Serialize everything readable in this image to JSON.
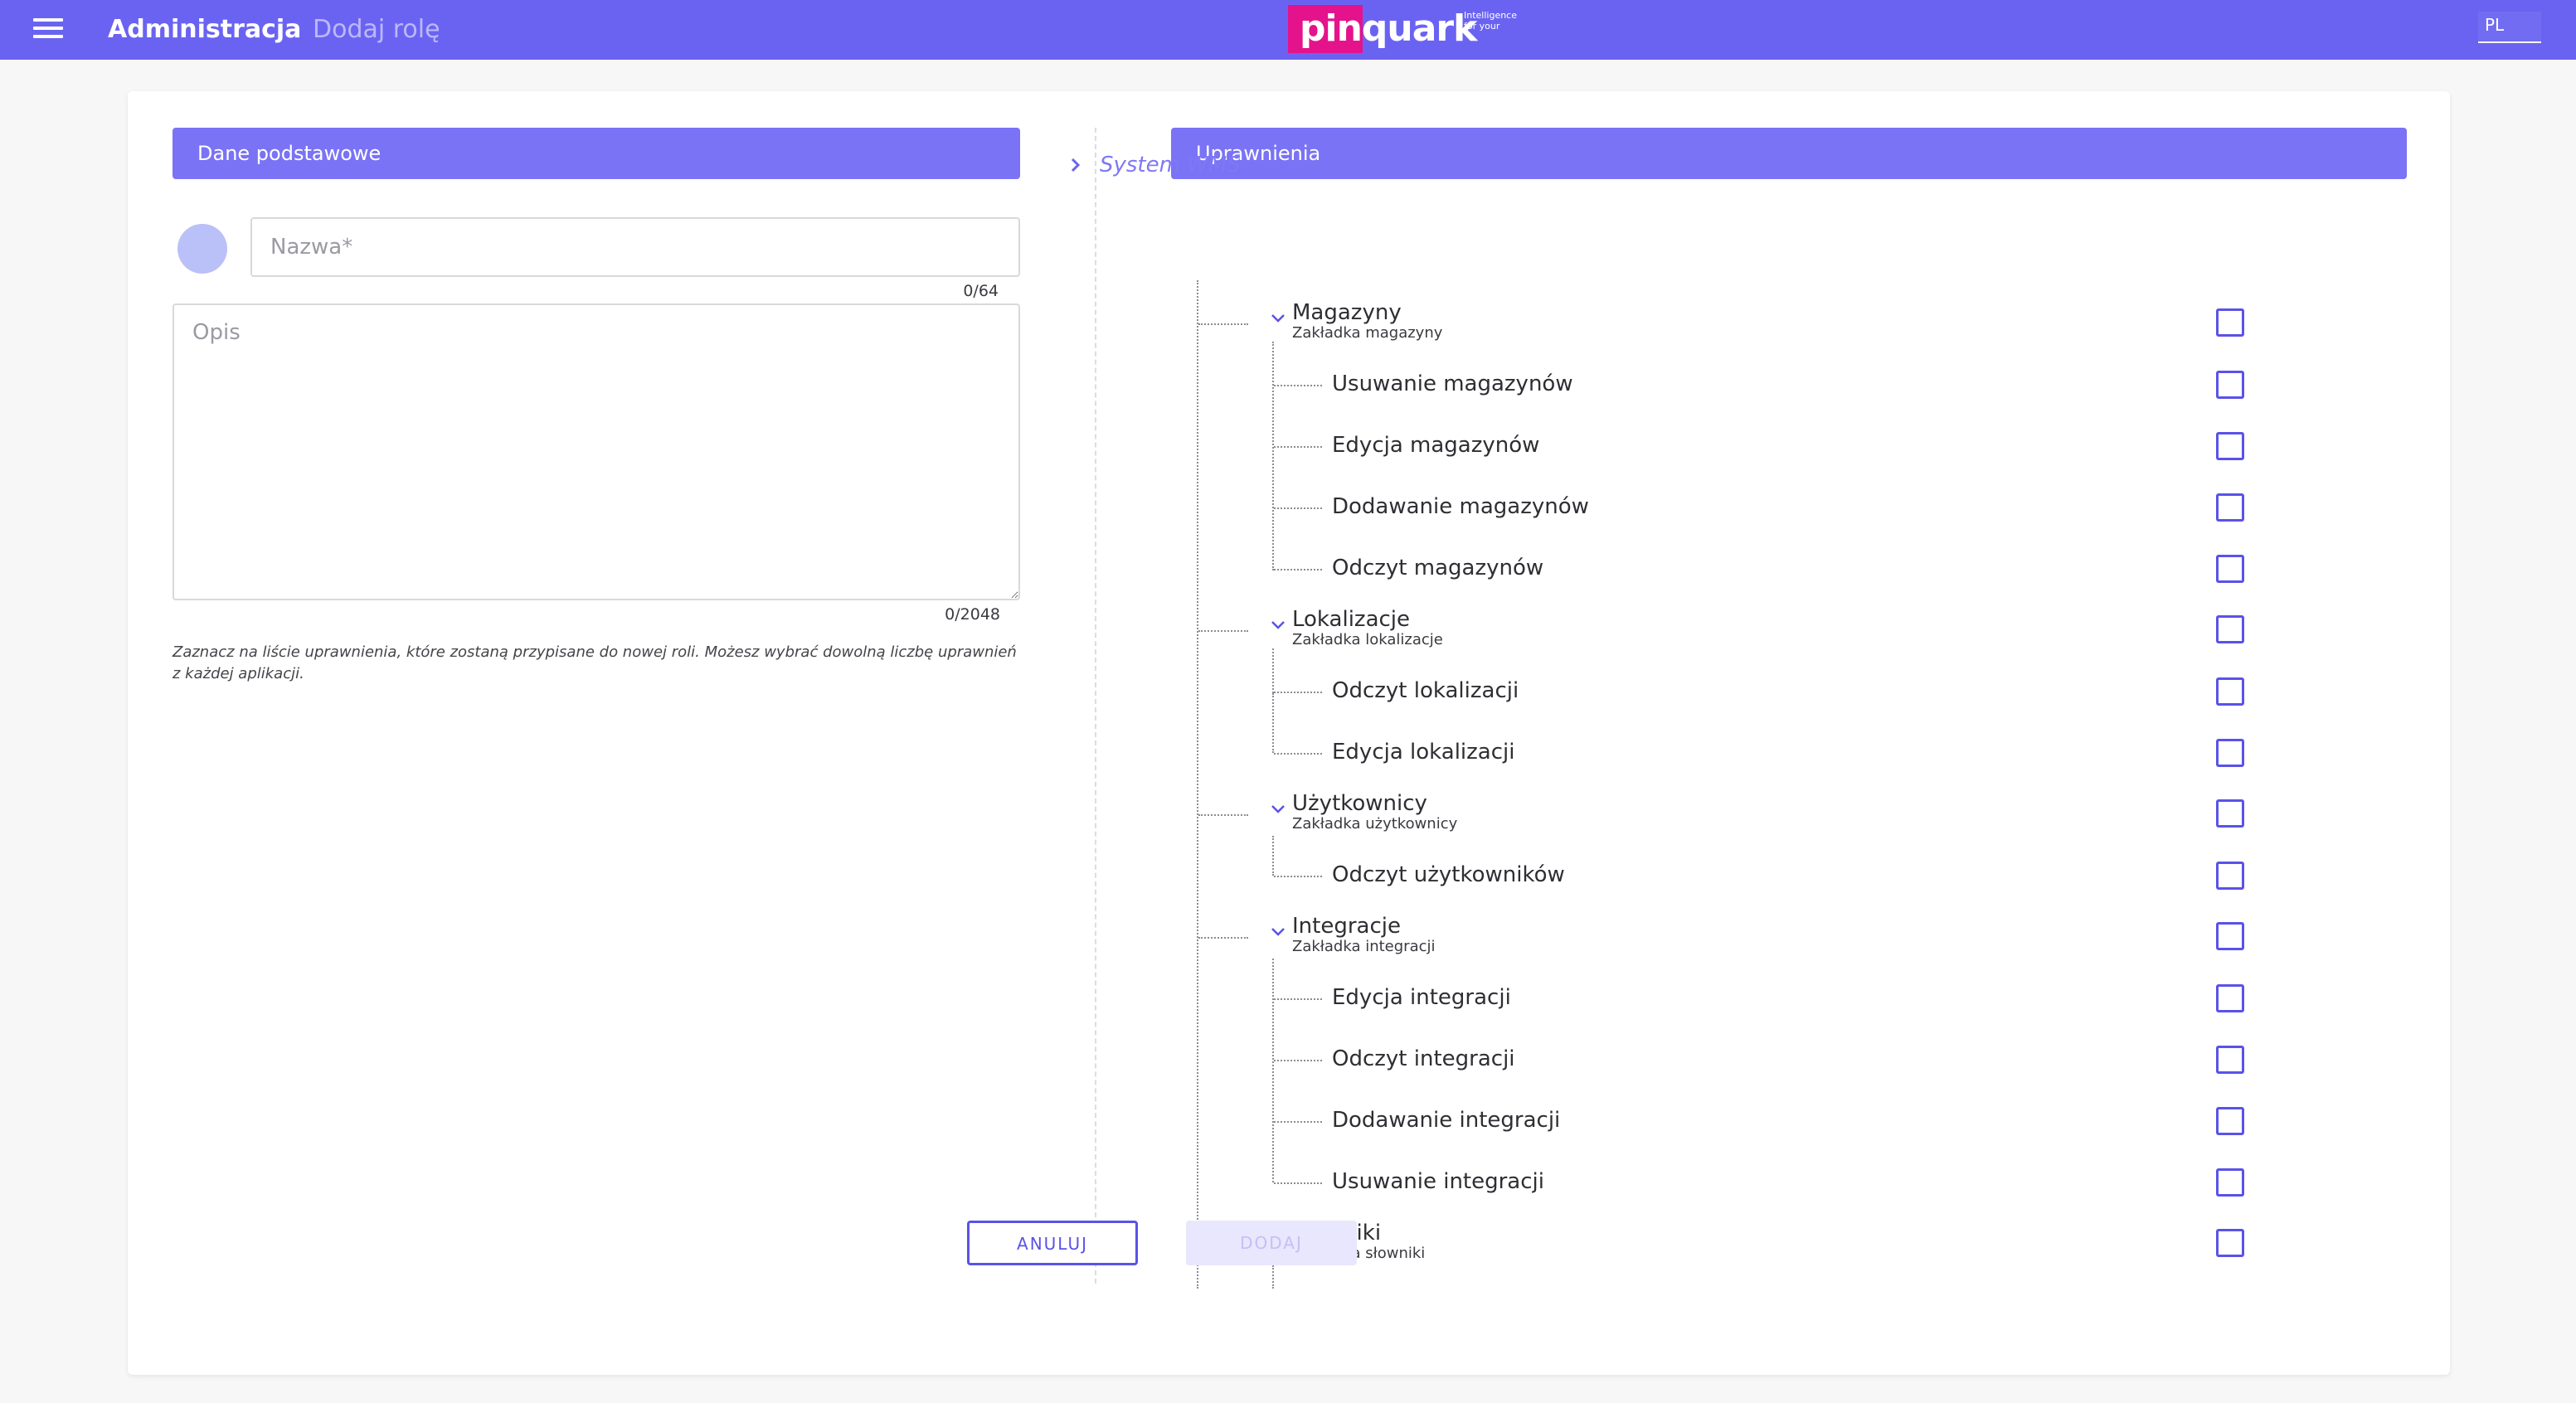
{
  "header": {
    "app_title": "Administracja",
    "page_title": "Dodaj rolę",
    "logo_text": "pinquark",
    "logo_tagline": "Intelligence for your",
    "language": "PL"
  },
  "colors": {
    "accent": "#6a63f2",
    "section_header": "#7a73f5",
    "logo_pink": "#e4138b",
    "checkbox_border": "#5a52e8"
  },
  "basic": {
    "section_title": "Dane podstawowe",
    "name_placeholder": "Nazwa*",
    "name_counter": "0/64",
    "description_placeholder": "Opis",
    "description_counter": "0/2048",
    "hint": "Zaznacz na liście uprawnienia, które zostaną przypisane do nowej roli. Możesz wybrać dowolną liczbę uprawnień z każdej aplikacji."
  },
  "permissions": {
    "section_title": "Uprawnienia",
    "root_label": "System WMS",
    "groups": [
      {
        "title": "Magazyny",
        "subtitle": "Zakładka magazyny",
        "children": [
          "Usuwanie magazynów",
          "Edycja magazynów",
          "Dodawanie magazynów",
          "Odczyt magazynów"
        ]
      },
      {
        "title": "Lokalizacje",
        "subtitle": "Zakładka lokalizacje",
        "children": [
          "Odczyt lokalizacji",
          "Edycja lokalizacji"
        ]
      },
      {
        "title": "Użytkownicy",
        "subtitle": "Zakładka użytkownicy",
        "children": [
          "Odczyt użytkowników"
        ]
      },
      {
        "title": "Integracje",
        "subtitle": "Zakładka integracji",
        "children": [
          "Edycja integracji",
          "Odczyt integracji",
          "Dodawanie integracji",
          "Usuwanie integracji"
        ]
      },
      {
        "title": "Słowniki",
        "subtitle": "Zakładka słowniki",
        "children": []
      }
    ]
  },
  "actions": {
    "cancel_label": "ANULUJ",
    "add_label": "DODAJ"
  }
}
